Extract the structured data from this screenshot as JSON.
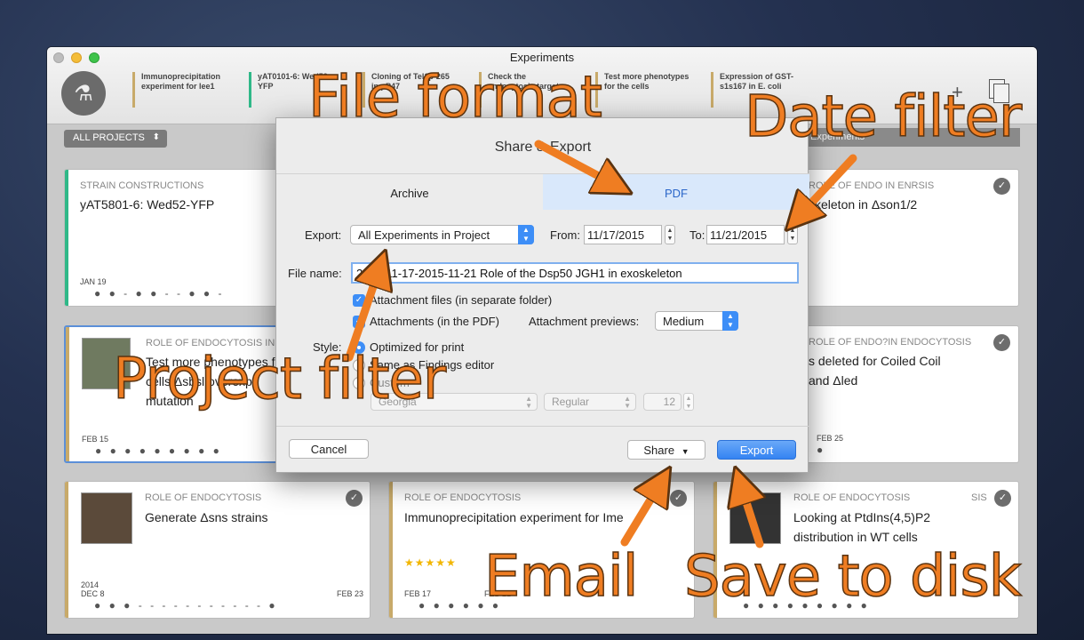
{
  "window": {
    "title": "Experiments"
  },
  "top_tabs": [
    {
      "lines": [
        "Immunoprecipitation",
        "experiment for lee1"
      ],
      "color": "#c8aa6a"
    },
    {
      "lines": [
        "yAT0101-6: Wed52-",
        "YFP"
      ],
      "color": "#2fb888"
    },
    {
      "lines": [
        "Cloning of Tel1p-265",
        "in pP47"
      ],
      "color": "#c8aa6a"
    },
    {
      "lines": [
        "Check the",
        "endocytosis target"
      ],
      "color": "#c8aa6a"
    },
    {
      "lines": [
        "Test more phenotypes",
        "for the cells"
      ],
      "color": "#c8aa6a"
    },
    {
      "lines": [
        "Expression of GST-",
        "s1s167 in E. coli"
      ],
      "color": "#c8aa6a"
    }
  ],
  "toolbar": {
    "all_projects": "ALL PROJECTS",
    "experiments_bar": "Experiments"
  },
  "cards": {
    "c1": {
      "project": "STRAIN CONSTRUCTIONS",
      "title": "yAT5801-6: Wed52-YFP",
      "date": "JAN 19"
    },
    "c2": {
      "project": "ROLE OF ENDOCYTOSIS IN ENDO",
      "title_lines": [
        "Test more phenotypes for",
        "cells Δsbsl overexpr.",
        "mutation"
      ],
      "date": "FEB 15"
    },
    "c3": {
      "project": "ROLE OF ENDOCYTOSIS",
      "title": "Generate Δsns  strains",
      "year": "2014",
      "date": "DEC 8",
      "date_end": "FEB 23"
    },
    "c4": {
      "project": "ROLE OF ENDOCYTOSIS",
      "title": "Immunoprecipitation experiment for Ime",
      "stars": "★★★★★",
      "date": "FEB 17",
      "date_end": "FEB 21"
    },
    "c5": {
      "project": "ROLE OF ENDOCYTOSIS",
      "title_lines": [
        "Looking at PtdIns(4,5)P2",
        "distribution in WT cells"
      ],
      "right_label": "SIS"
    },
    "c6": {
      "project": "ROLE OF ENDO IN ENRSIS",
      "title": "skeleton in Δson1/2"
    },
    "c7": {
      "project": "ROLE OF ENDO?IN ENDOCYTOSIS",
      "title_lines": [
        "s deleted for Coiled Coil",
        "and Δled"
      ],
      "date": "FEB 25"
    }
  },
  "dialog": {
    "title": "Share & Export",
    "tabs": {
      "archive": "Archive",
      "pdf": "PDF"
    },
    "export_label": "Export:",
    "export_value": "All Experiments in Project",
    "from_label": "From:",
    "from_value": "11/17/2015",
    "to_label": "To:",
    "to_value": "11/21/2015",
    "file_name_label": "File name:",
    "file_name_value": "2015-11-17-2015-11-21 Role of the Dsp50 JGH1 in exoskeleton",
    "attachment_files": "Attachment files (in separate folder)",
    "attachments_pdf": "Attachments (in the PDF)",
    "attachment_previews_label": "Attachment previews:",
    "attachment_previews_value": "Medium",
    "style_label": "Style:",
    "style_print": "Optimized for print",
    "style_findings": "Same as Findings editor",
    "style_custom": "Custom",
    "font_family": "Georgia",
    "font_weight": "Regular",
    "font_size": "12",
    "cancel": "Cancel",
    "share": "Share",
    "export": "Export"
  },
  "annotations": {
    "file_format": "File format",
    "date_filter": "Date filter",
    "project_filter": "Project filter",
    "email": "Email",
    "save_to_disk": "Save to disk",
    "color": "#ef7d22"
  }
}
